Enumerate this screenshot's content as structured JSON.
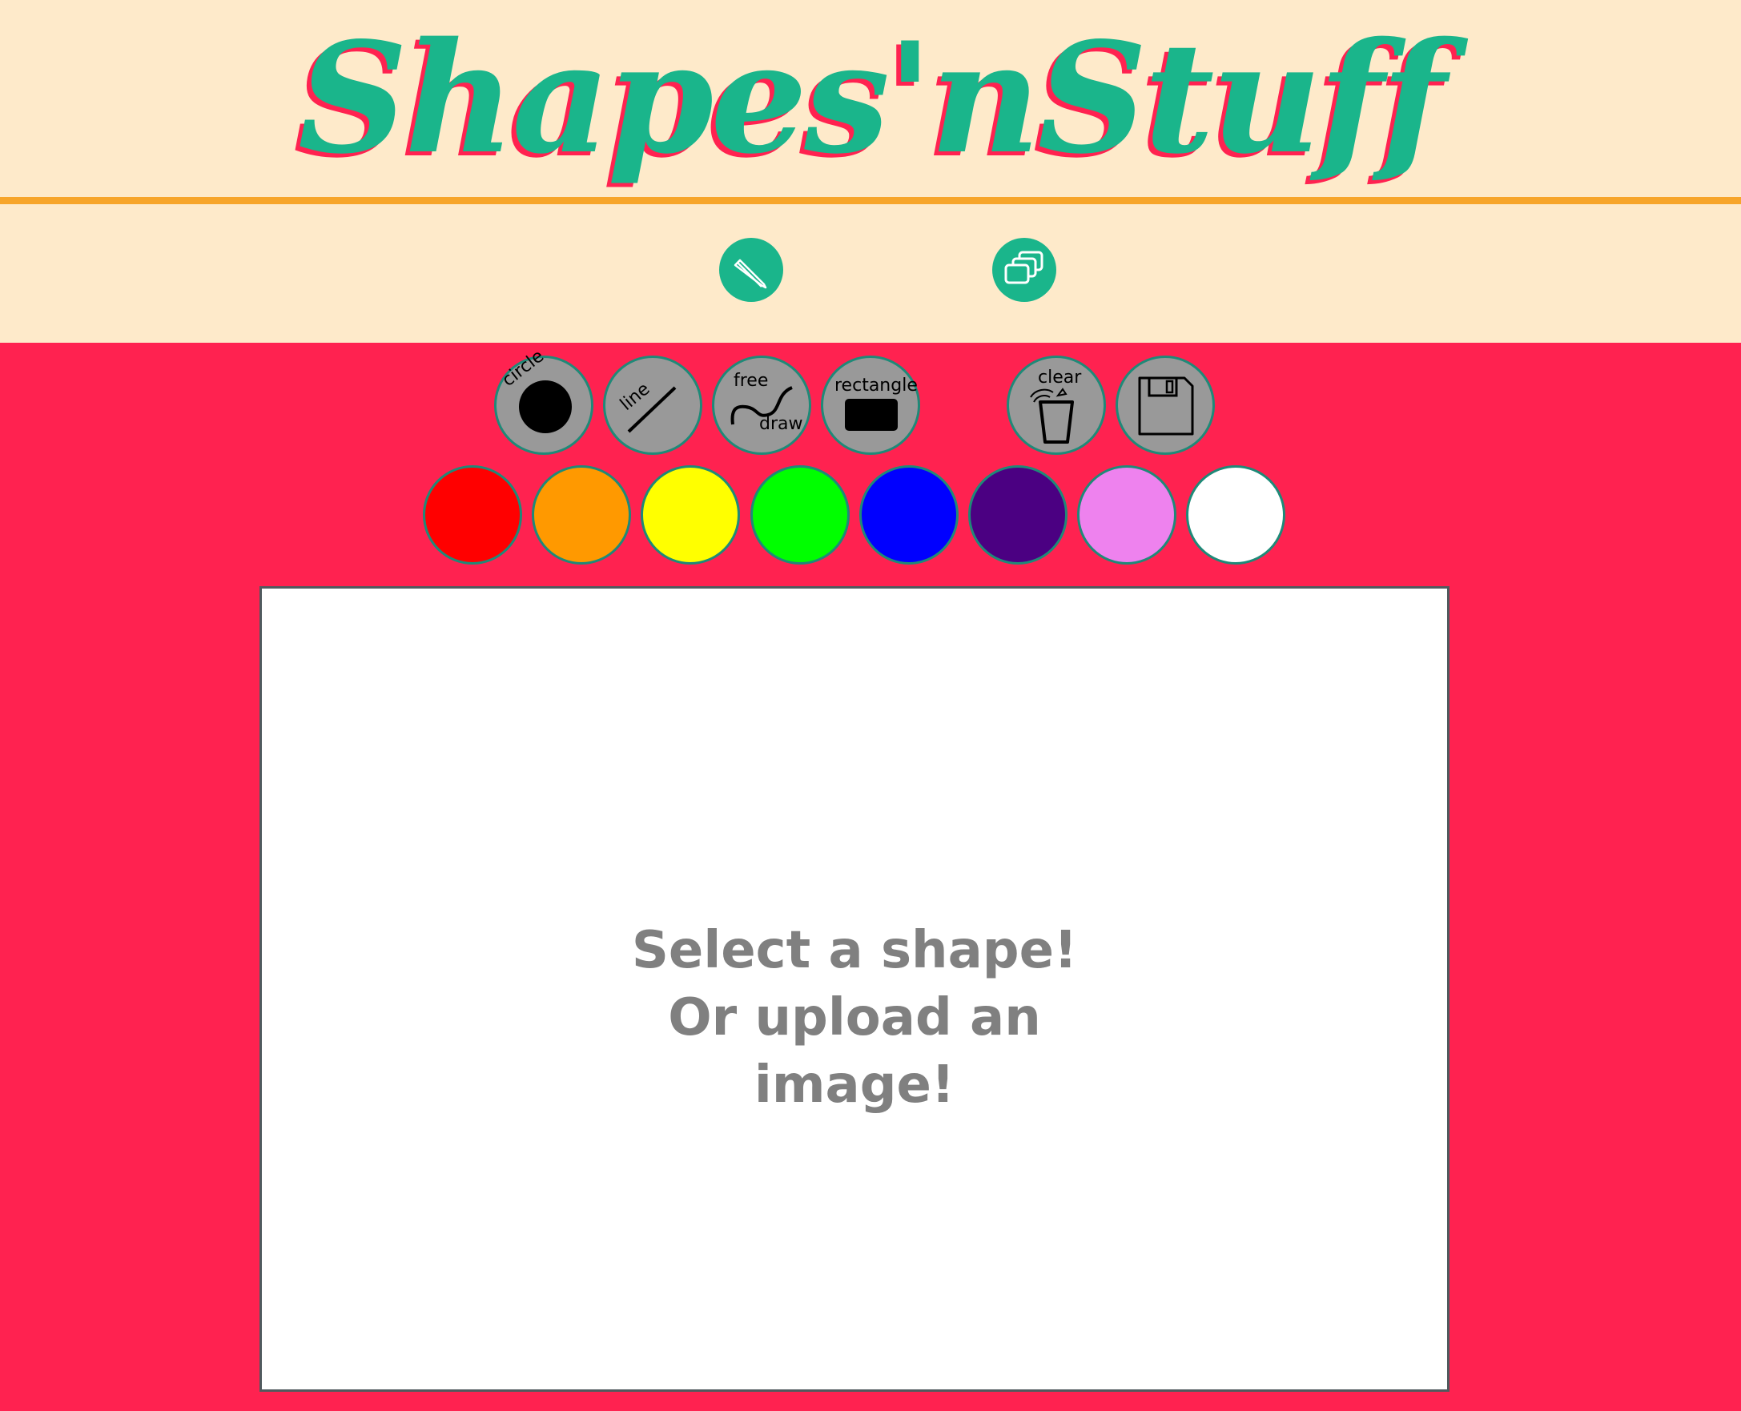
{
  "header": {
    "title": "Shapes'nStuff",
    "mode_buttons": [
      {
        "name": "draw-mode",
        "icon": "pencil-icon"
      },
      {
        "name": "layers-mode",
        "icon": "layers-icon"
      }
    ]
  },
  "tools": [
    {
      "label": "circle",
      "icon": "circle-icon"
    },
    {
      "label": "line",
      "icon": "line-icon"
    },
    {
      "label_top": "free",
      "label_bottom": "draw",
      "icon": "squiggle-icon"
    },
    {
      "label": "rectangle",
      "icon": "rectangle-icon"
    },
    {
      "label": "clear",
      "icon": "trash-icon"
    },
    {
      "icon": "floppy-disk-icon"
    }
  ],
  "colors": [
    {
      "name": "red",
      "hex": "#ff0000"
    },
    {
      "name": "orange",
      "hex": "#ff9900"
    },
    {
      "name": "yellow",
      "hex": "#ffff00"
    },
    {
      "name": "green",
      "hex": "#00ff00"
    },
    {
      "name": "blue",
      "hex": "#0000ff"
    },
    {
      "name": "purple",
      "hex": "#4b0082"
    },
    {
      "name": "pink",
      "hex": "#ee82ee"
    },
    {
      "name": "white",
      "hex": "#ffffff"
    }
  ],
  "canvas": {
    "message_lines": [
      "Select a shape!",
      "Or upload an",
      "image!"
    ]
  },
  "theme": {
    "header_bg": "#feeaca",
    "page_bg": "#ff2250",
    "accent": "#1ab58b",
    "divider": "#f7a52a"
  }
}
